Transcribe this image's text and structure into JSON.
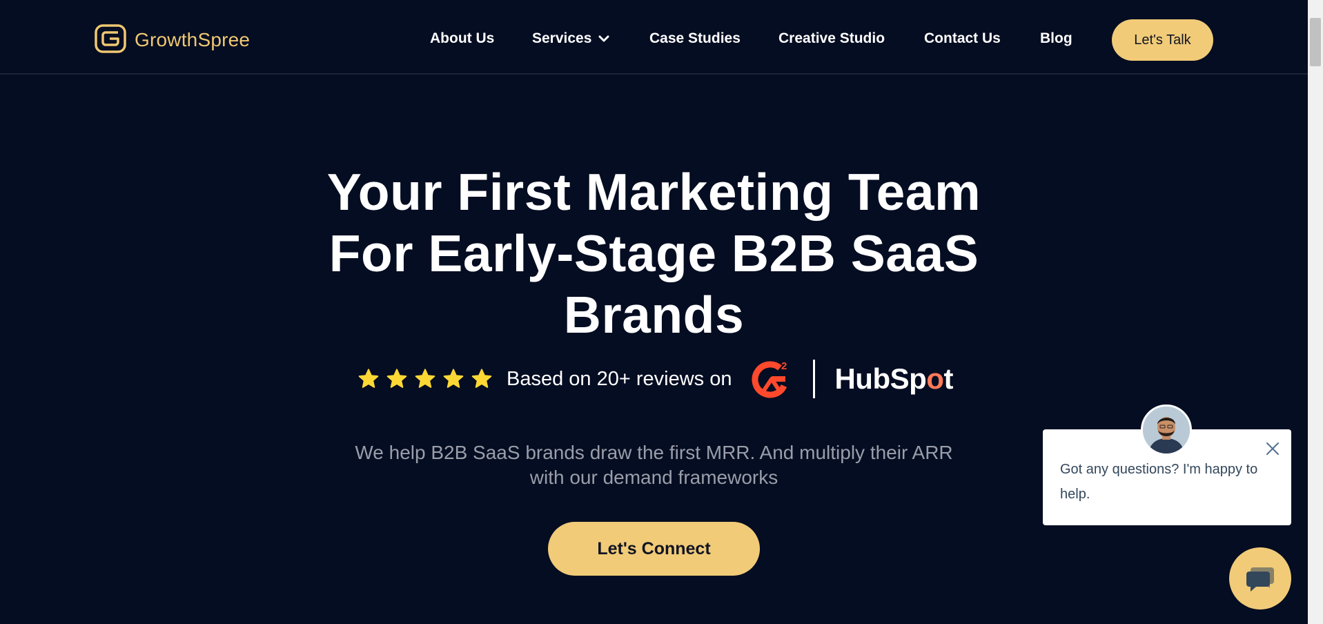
{
  "brand": {
    "name": "GrowthSpree",
    "logo_icon": "growthspree-g-icon",
    "accent_color": "#f1cb78",
    "background_color": "#050d22"
  },
  "nav": {
    "items": [
      {
        "label": "About Us"
      },
      {
        "label": "Services",
        "has_dropdown": true
      },
      {
        "label": "Case Studies"
      },
      {
        "label": "Creative Studio"
      },
      {
        "label": "Contact Us"
      },
      {
        "label": "Blog"
      }
    ],
    "cta_label": "Let's Talk"
  },
  "hero": {
    "title_lines": [
      "Your First Marketing Team",
      "For Early-Stage B2B SaaS",
      "Brands"
    ],
    "rating": {
      "stars": 5,
      "text": "Based on 20+ reviews on",
      "platform_icons": [
        "g2-logo",
        "hubspot-logo"
      ],
      "hubspot_text": "HubSpot"
    },
    "subtitle_lines": [
      "We help B2B SaaS brands draw the first MRR. And multiply their ARR",
      "with our demand frameworks"
    ],
    "cta_label": "Let's Connect"
  },
  "chat": {
    "message": "Got any questions? I'm happy to help.",
    "close_icon": "close-icon",
    "launcher_icon": "chat-bubble-icon"
  }
}
